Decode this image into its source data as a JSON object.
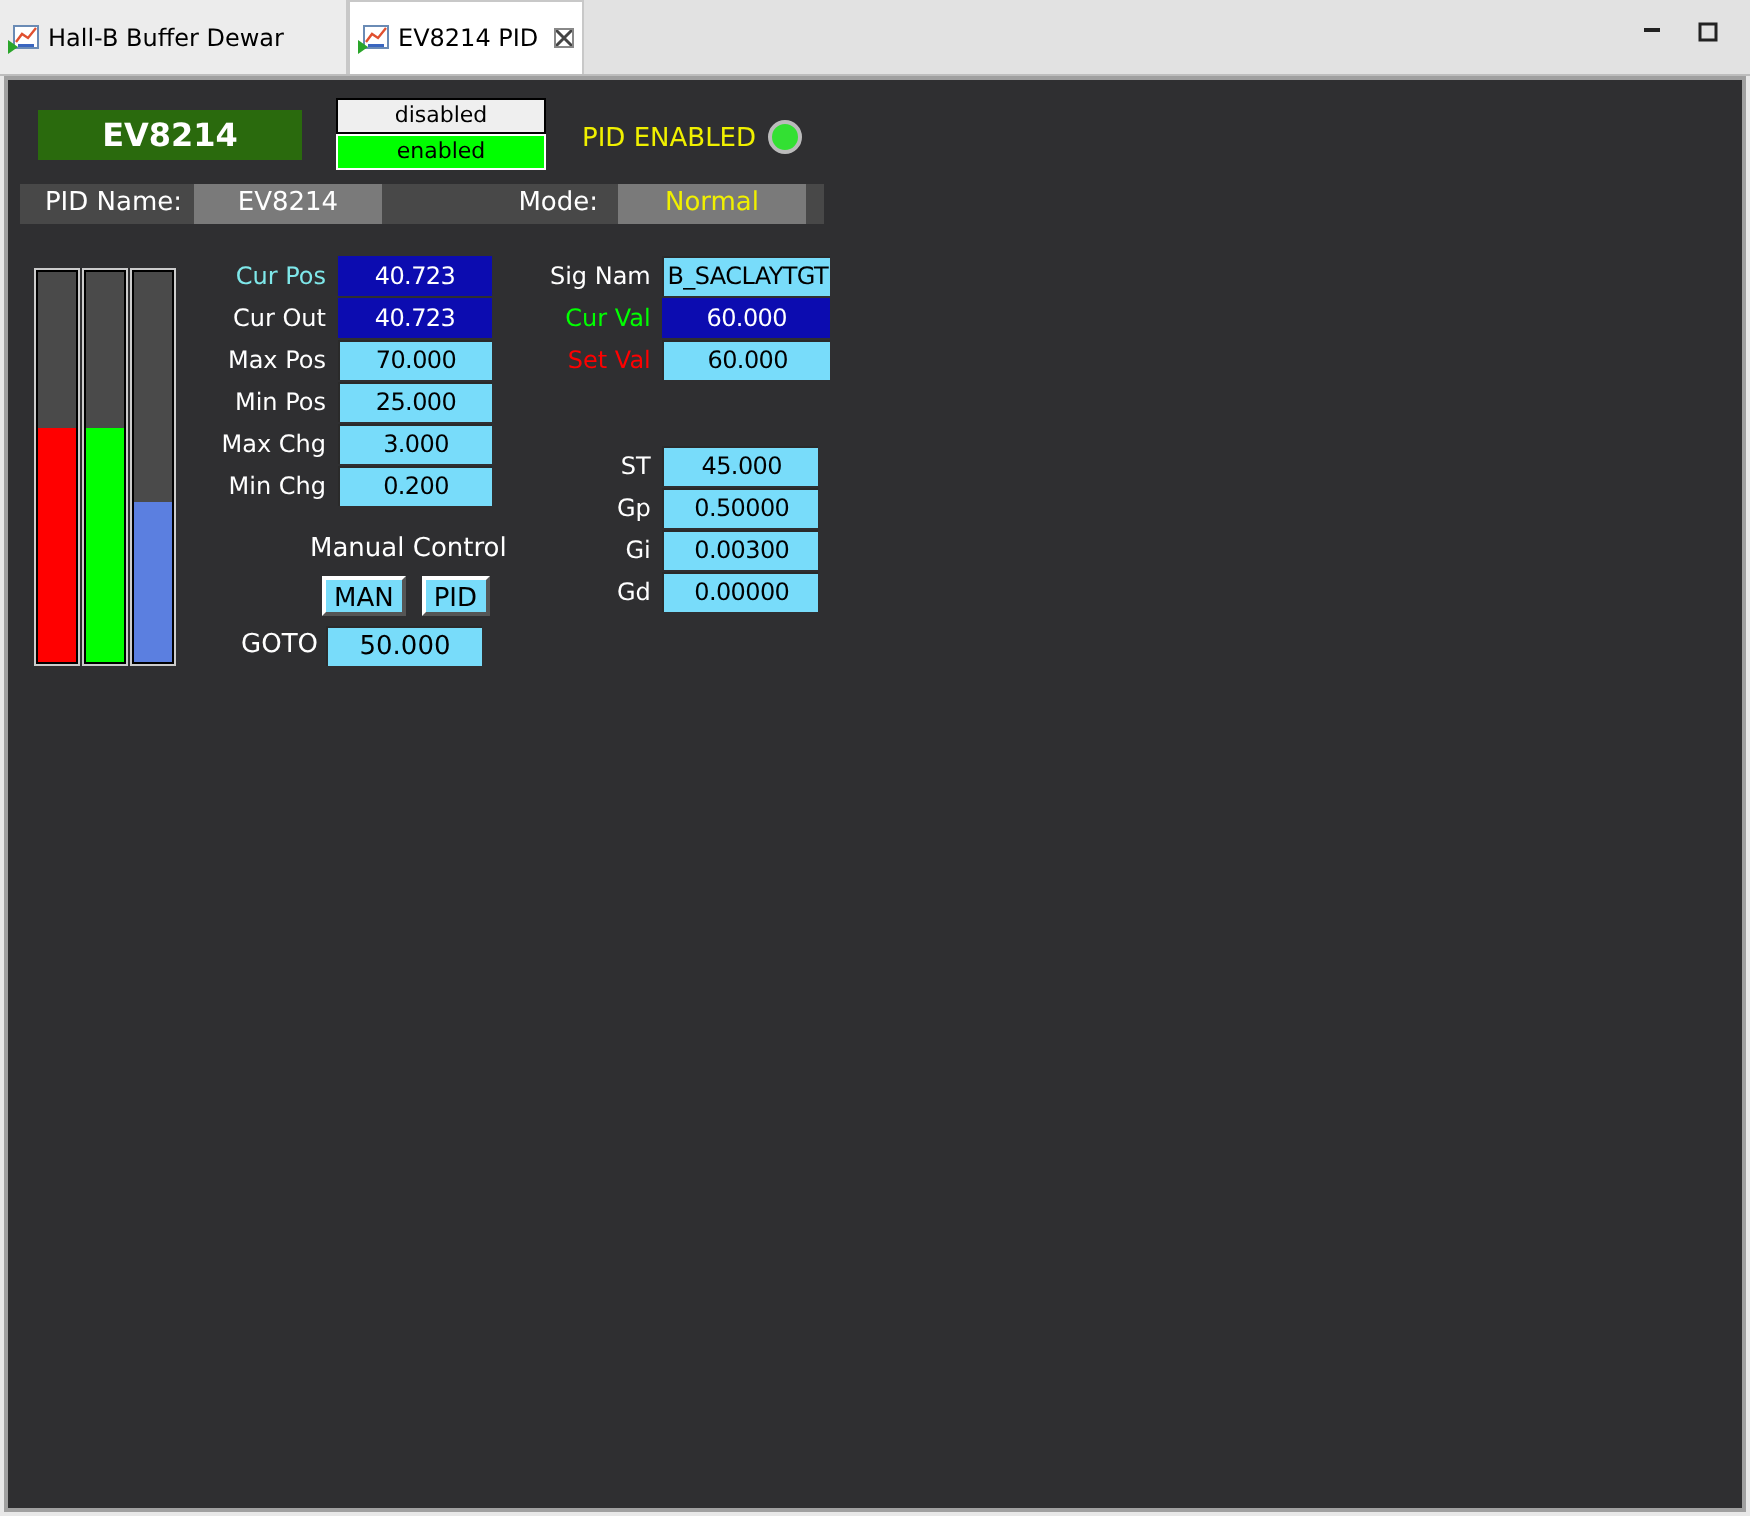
{
  "tabs": [
    {
      "label": "Hall-B Buffer Dewar",
      "selected": false
    },
    {
      "label": "EV8214 PID",
      "selected": true
    }
  ],
  "header": {
    "title": "EV8214",
    "mode_buttons": [
      {
        "label": "disabled",
        "selected": false
      },
      {
        "label": "enabled",
        "selected": true
      }
    ],
    "status": {
      "label": "PID ENABLED",
      "on": true
    }
  },
  "info": {
    "pid_name_label": "PID Name:",
    "pid_name": "EV8214",
    "mode_label": "Mode:",
    "mode": "Normal"
  },
  "bars": [
    {
      "color": "#ff0000",
      "level": 0.6
    },
    {
      "color": "#00ff00",
      "level": 0.6
    },
    {
      "color": "#5b7fe0",
      "level": 0.41
    }
  ],
  "left_fields": [
    {
      "label": "Cur Pos",
      "color": "#7fe8ea",
      "value": "40.723",
      "kind": "readback"
    },
    {
      "label": "Cur Out",
      "color": "#ffffff",
      "value": "40.723",
      "kind": "readback"
    },
    {
      "label": "Max Pos",
      "color": "#ffffff",
      "value": "70.000",
      "kind": "entry"
    },
    {
      "label": "Min Pos",
      "color": "#ffffff",
      "value": "25.000",
      "kind": "entry"
    },
    {
      "label": "Max Chg",
      "color": "#ffffff",
      "value": "3.000",
      "kind": "entry"
    },
    {
      "label": "Min Chg",
      "color": "#ffffff",
      "value": "0.200",
      "kind": "entry"
    }
  ],
  "manual": {
    "label": "Manual Control",
    "buttons": [
      "MAN",
      "PID"
    ]
  },
  "goto": {
    "label": "GOTO",
    "value": "50.000"
  },
  "right_fields": [
    {
      "label": "Sig Nam",
      "color": "#ffffff",
      "value": "B_SACLAYTGT",
      "kind": "entry"
    },
    {
      "label": "Cur Val",
      "color": "#00ff00",
      "value": "60.000",
      "kind": "readback"
    },
    {
      "label": "Set Val",
      "color": "#ff0000",
      "value": "60.000",
      "kind": "entry"
    }
  ],
  "gain_fields": [
    {
      "label": "ST",
      "color": "#ffffff",
      "value": "45.000",
      "kind": "entry"
    },
    {
      "label": "Gp",
      "color": "#ffffff",
      "value": "0.50000",
      "kind": "entry"
    },
    {
      "label": "Gi",
      "color": "#ffffff",
      "value": "0.00300",
      "kind": "entry"
    },
    {
      "label": "Gd",
      "color": "#ffffff",
      "value": "0.00000",
      "kind": "entry"
    }
  ]
}
